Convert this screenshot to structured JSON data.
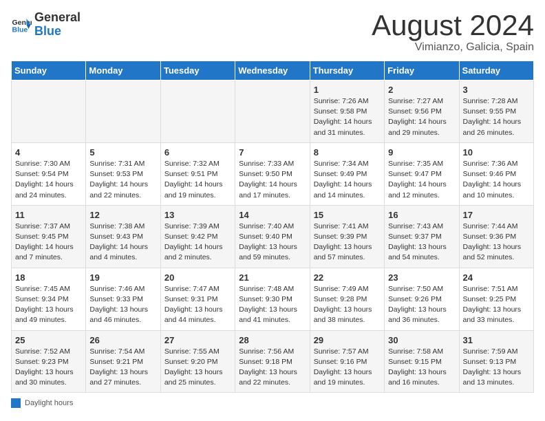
{
  "logo": {
    "line1": "General",
    "line2": "Blue"
  },
  "title": "August 2024",
  "subtitle": "Vimianzo, Galicia, Spain",
  "days_of_week": [
    "Sunday",
    "Monday",
    "Tuesday",
    "Wednesday",
    "Thursday",
    "Friday",
    "Saturday"
  ],
  "weeks": [
    [
      {
        "day": "",
        "info": ""
      },
      {
        "day": "",
        "info": ""
      },
      {
        "day": "",
        "info": ""
      },
      {
        "day": "",
        "info": ""
      },
      {
        "day": "1",
        "info": "Sunrise: 7:26 AM\nSunset: 9:58 PM\nDaylight: 14 hours and 31 minutes."
      },
      {
        "day": "2",
        "info": "Sunrise: 7:27 AM\nSunset: 9:56 PM\nDaylight: 14 hours and 29 minutes."
      },
      {
        "day": "3",
        "info": "Sunrise: 7:28 AM\nSunset: 9:55 PM\nDaylight: 14 hours and 26 minutes."
      }
    ],
    [
      {
        "day": "4",
        "info": "Sunrise: 7:30 AM\nSunset: 9:54 PM\nDaylight: 14 hours and 24 minutes."
      },
      {
        "day": "5",
        "info": "Sunrise: 7:31 AM\nSunset: 9:53 PM\nDaylight: 14 hours and 22 minutes."
      },
      {
        "day": "6",
        "info": "Sunrise: 7:32 AM\nSunset: 9:51 PM\nDaylight: 14 hours and 19 minutes."
      },
      {
        "day": "7",
        "info": "Sunrise: 7:33 AM\nSunset: 9:50 PM\nDaylight: 14 hours and 17 minutes."
      },
      {
        "day": "8",
        "info": "Sunrise: 7:34 AM\nSunset: 9:49 PM\nDaylight: 14 hours and 14 minutes."
      },
      {
        "day": "9",
        "info": "Sunrise: 7:35 AM\nSunset: 9:47 PM\nDaylight: 14 hours and 12 minutes."
      },
      {
        "day": "10",
        "info": "Sunrise: 7:36 AM\nSunset: 9:46 PM\nDaylight: 14 hours and 10 minutes."
      }
    ],
    [
      {
        "day": "11",
        "info": "Sunrise: 7:37 AM\nSunset: 9:45 PM\nDaylight: 14 hours and 7 minutes."
      },
      {
        "day": "12",
        "info": "Sunrise: 7:38 AM\nSunset: 9:43 PM\nDaylight: 14 hours and 4 minutes."
      },
      {
        "day": "13",
        "info": "Sunrise: 7:39 AM\nSunset: 9:42 PM\nDaylight: 14 hours and 2 minutes."
      },
      {
        "day": "14",
        "info": "Sunrise: 7:40 AM\nSunset: 9:40 PM\nDaylight: 13 hours and 59 minutes."
      },
      {
        "day": "15",
        "info": "Sunrise: 7:41 AM\nSunset: 9:39 PM\nDaylight: 13 hours and 57 minutes."
      },
      {
        "day": "16",
        "info": "Sunrise: 7:43 AM\nSunset: 9:37 PM\nDaylight: 13 hours and 54 minutes."
      },
      {
        "day": "17",
        "info": "Sunrise: 7:44 AM\nSunset: 9:36 PM\nDaylight: 13 hours and 52 minutes."
      }
    ],
    [
      {
        "day": "18",
        "info": "Sunrise: 7:45 AM\nSunset: 9:34 PM\nDaylight: 13 hours and 49 minutes."
      },
      {
        "day": "19",
        "info": "Sunrise: 7:46 AM\nSunset: 9:33 PM\nDaylight: 13 hours and 46 minutes."
      },
      {
        "day": "20",
        "info": "Sunrise: 7:47 AM\nSunset: 9:31 PM\nDaylight: 13 hours and 44 minutes."
      },
      {
        "day": "21",
        "info": "Sunrise: 7:48 AM\nSunset: 9:30 PM\nDaylight: 13 hours and 41 minutes."
      },
      {
        "day": "22",
        "info": "Sunrise: 7:49 AM\nSunset: 9:28 PM\nDaylight: 13 hours and 38 minutes."
      },
      {
        "day": "23",
        "info": "Sunrise: 7:50 AM\nSunset: 9:26 PM\nDaylight: 13 hours and 36 minutes."
      },
      {
        "day": "24",
        "info": "Sunrise: 7:51 AM\nSunset: 9:25 PM\nDaylight: 13 hours and 33 minutes."
      }
    ],
    [
      {
        "day": "25",
        "info": "Sunrise: 7:52 AM\nSunset: 9:23 PM\nDaylight: 13 hours and 30 minutes."
      },
      {
        "day": "26",
        "info": "Sunrise: 7:54 AM\nSunset: 9:21 PM\nDaylight: 13 hours and 27 minutes."
      },
      {
        "day": "27",
        "info": "Sunrise: 7:55 AM\nSunset: 9:20 PM\nDaylight: 13 hours and 25 minutes."
      },
      {
        "day": "28",
        "info": "Sunrise: 7:56 AM\nSunset: 9:18 PM\nDaylight: 13 hours and 22 minutes."
      },
      {
        "day": "29",
        "info": "Sunrise: 7:57 AM\nSunset: 9:16 PM\nDaylight: 13 hours and 19 minutes."
      },
      {
        "day": "30",
        "info": "Sunrise: 7:58 AM\nSunset: 9:15 PM\nDaylight: 13 hours and 16 minutes."
      },
      {
        "day": "31",
        "info": "Sunrise: 7:59 AM\nSunset: 9:13 PM\nDaylight: 13 hours and 13 minutes."
      }
    ]
  ],
  "footer": {
    "label": "Daylight hours"
  }
}
